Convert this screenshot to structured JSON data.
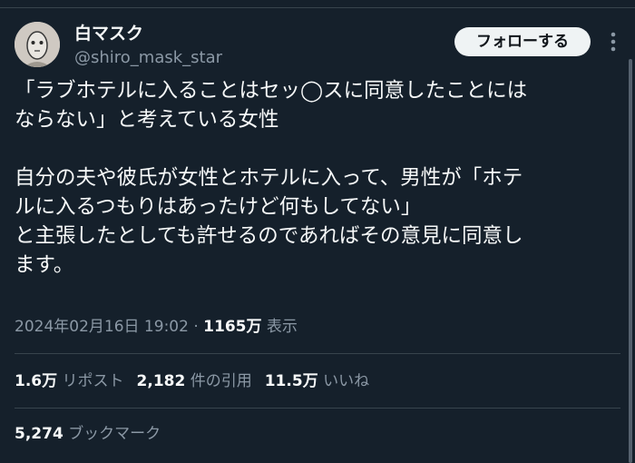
{
  "user": {
    "display_name": "白マスク",
    "handle": "@shiro_mask_star",
    "avatar_icon": "mask-face-avatar"
  },
  "follow_button": {
    "label": "フォローする"
  },
  "tweet": {
    "line1": "「ラブホテルに入ることはセッ◯スに同意したことには",
    "line2": "ならない」と考えている女性",
    "line3": "自分の夫や彼氏が女性とホテルに入って、男性が「ホテ",
    "line4": "ルに入るつもりはあったけど何もしてない」",
    "line5": "と主張したとしても許せるのであればその意見に同意し",
    "line6": "ます。"
  },
  "meta": {
    "timestamp": "2024年02月16日 19:02",
    "separator": " · ",
    "views": "1165万",
    "views_label": " 表示"
  },
  "stats": {
    "retweets": "1.6万",
    "retweets_label": "リポスト",
    "quotes": "2,182",
    "quotes_label": "件の引用",
    "likes": "11.5万",
    "likes_label": "いいね"
  },
  "bookmarks": {
    "count": "5,274",
    "label": "ブックマーク"
  },
  "colors": {
    "background": "#15202b",
    "text": "#f7f9f9",
    "secondary": "#8b98a5",
    "divider": "#38444d",
    "button_bg": "#eff3f4"
  }
}
